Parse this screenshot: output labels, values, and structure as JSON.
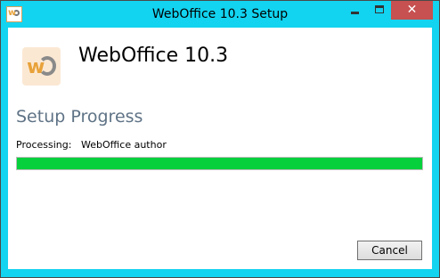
{
  "window": {
    "title": "WebOffice 10.3 Setup",
    "controls": {
      "minimize": "minimize",
      "maximize": "maximize",
      "close": "✕"
    }
  },
  "header": {
    "product_title": "WebOffice 10.3",
    "logo_icon": "weboffice-logo-icon"
  },
  "main": {
    "section_title": "Setup Progress",
    "processing_label": "Processing:",
    "processing_value": "WebOffice author",
    "progress_fraction": 1.0
  },
  "footer": {
    "cancel_label": "Cancel"
  },
  "colors": {
    "titlebar": "#12d3f0",
    "close_button": "#c75050",
    "progress_fill": "#06d03c",
    "section_title": "#5f7386"
  }
}
